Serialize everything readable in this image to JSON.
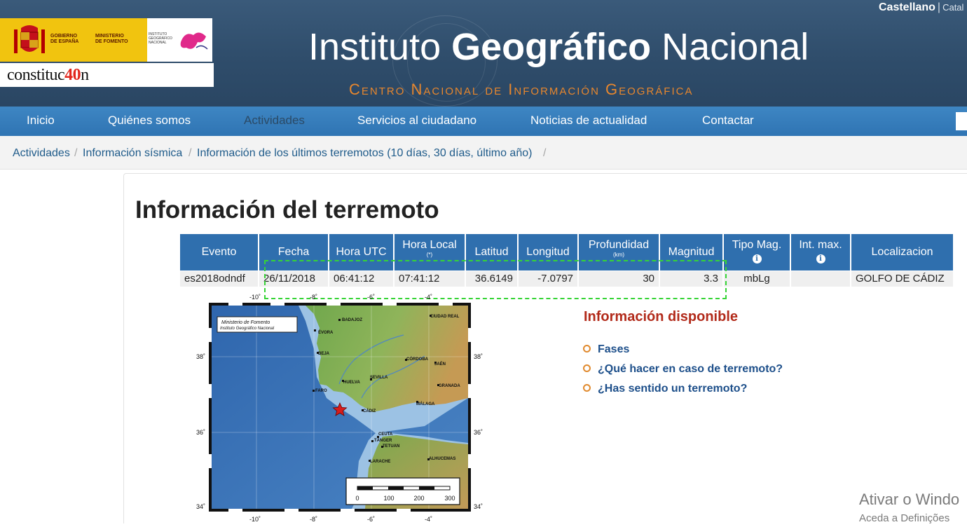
{
  "header": {
    "gov_line1": "GOBIERNO",
    "gov_line2": "DE ESPAÑA",
    "ministry_line1": "MINISTERIO",
    "ministry_line2": "DE FOMENTO",
    "ign_small": "INSTITUTO GEOGRÁFICO NACIONAL",
    "constitution_prefix": "constituc",
    "constitution_40": "40",
    "constitution_suffix": "n",
    "title_a": "Instituto ",
    "title_b": "Geográfico",
    "title_c": " Nacional",
    "subtitle": "Centro Nacional de Información Geográfica",
    "lang_active": "Castellano",
    "lang_other": "Catal"
  },
  "nav": {
    "items": [
      "Inicio",
      "Quiénes somos",
      "Actividades",
      "Servicios al ciudadano",
      "Noticias de actualidad",
      "Contactar"
    ],
    "active_index": 2
  },
  "breadcrumb": {
    "items": [
      "Actividades",
      "Información sísmica",
      "Información de los últimos terremotos (10 días, 30 días, último año)"
    ],
    "separator": "/"
  },
  "page": {
    "title": "Información del terremoto"
  },
  "table": {
    "headers": {
      "evento": "Evento",
      "fecha": "Fecha",
      "hora_utc": "Hora UTC",
      "hora_local": "Hora Local",
      "hora_local_note": "(*)",
      "latitud": "Latitud",
      "longitud": "Longitud",
      "profundidad": "Profundidad",
      "profundidad_unit": "(km)",
      "magnitud": "Magnitud",
      "tipo_mag": "Tipo Mag.",
      "int_max": "Int. max.",
      "localizacion": "Localizacion"
    },
    "row": {
      "evento": "es2018odndf",
      "fecha": "26/11/2018",
      "hora_utc": "06:41:12",
      "hora_local": "07:41:12",
      "latitud": "36.6149",
      "longitud": "-7.0797",
      "profundidad": "30",
      "magnitud": "3.3",
      "tipo_mag": "mbLg",
      "int_max": "",
      "localizacion": "GOLFO DE CÁDIZ"
    },
    "info_icon": "i"
  },
  "map": {
    "credit_line1": "Ministerio de Fomento",
    "credit_line2": "Instituto Geográfico Nacional",
    "lon_ticks": [
      "-10˚",
      "-8˚",
      "-6˚",
      "-4˚"
    ],
    "lat_ticks": [
      "38˚",
      "36˚",
      "34˚"
    ],
    "cities": [
      "BADAJOZ",
      "CIUDAD REAL",
      "ÉVORA",
      "BEJA",
      "CÓRDOBA",
      "JAÉN",
      "HUELVA",
      "SEVILLA",
      "GRANADA",
      "FARO",
      "CÁDIZ",
      "MÁLAGA",
      "CEUTA",
      "TÁNGER",
      "TETUAN",
      "ALHUCEMAS",
      "LARACHE"
    ],
    "scale_labels": [
      "0",
      "100",
      "200",
      "300"
    ],
    "colors": {
      "sea_deep": "#3d73b8",
      "sea_shallow": "#9cc2e4",
      "land_low": "#6fa74c",
      "land_high": "#c59a54",
      "epicenter": "#d61d1d"
    }
  },
  "info": {
    "title": "Información disponible",
    "links": [
      "Fases",
      "¿Qué hacer en caso de terremoto?",
      "¿Has sentido un terremoto?"
    ]
  },
  "watermark": {
    "line1": "Ativar o Windo",
    "line2": "Aceda a Definições"
  }
}
